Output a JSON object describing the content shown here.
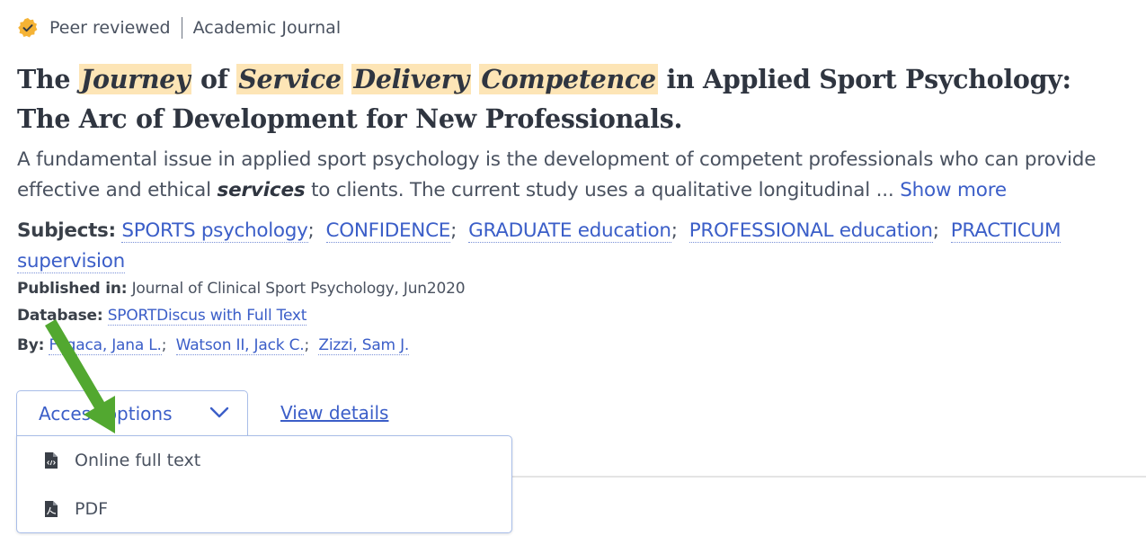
{
  "record": {
    "peer_reviewed": "Peer reviewed",
    "source_type": "Academic Journal",
    "title_parts": [
      {
        "text": "The ",
        "highlight": false
      },
      {
        "text": "Journey",
        "highlight": true
      },
      {
        "text": " of ",
        "highlight": false
      },
      {
        "text": "Service",
        "highlight": true
      },
      {
        "text": " ",
        "highlight": false
      },
      {
        "text": "Delivery",
        "highlight": true
      },
      {
        "text": " ",
        "highlight": false
      },
      {
        "text": "Competence",
        "highlight": true
      },
      {
        "text": " in Applied Sport Psychology: The Arc of Development for New Professionals.",
        "highlight": false
      }
    ],
    "abstract_before": "A fundamental issue in applied sport psychology is the development of competent professionals who can provide effective and ethical ",
    "abstract_emphasis": "services",
    "abstract_after": " to clients. The current study uses a qualitative longitudinal ... ",
    "show_more": "Show more",
    "subjects_label": "Subjects:",
    "subjects": [
      "SPORTS psychology",
      "CONFIDENCE",
      "GRADUATE education",
      "PROFESSIONAL education",
      "PRACTICUM supervision"
    ],
    "published_label": "Published in:",
    "published_value": "Journal of Clinical Sport Psychology, Jun2020",
    "database_label": "Database:",
    "database_value": "SPORTDiscus with Full Text",
    "by_label": "By:",
    "authors": [
      "Fogaca, Jana L.",
      "Watson II, Jack C.",
      "Zizzi, Sam J."
    ]
  },
  "actions": {
    "access_options": "Access options",
    "view_details": "View details"
  },
  "access_menu": {
    "items": [
      {
        "label": "Online full text",
        "icon": "html-file-icon"
      },
      {
        "label": "PDF",
        "icon": "pdf-file-icon"
      }
    ]
  },
  "colors": {
    "link": "#3b5ec8",
    "highlight": "#fde5b6",
    "badge": "#f5b335",
    "arrow": "#52a830"
  }
}
